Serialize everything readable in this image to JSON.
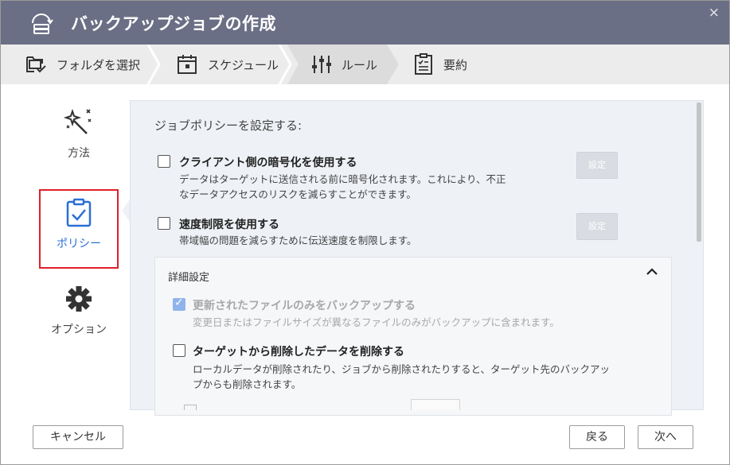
{
  "window": {
    "title": "バックアップジョブの作成",
    "close_glyph": "×"
  },
  "steps": [
    {
      "label": "フォルダを選択",
      "icon": "folder-select-icon"
    },
    {
      "label": "スケジュール",
      "icon": "calendar-icon"
    },
    {
      "label": "ルール",
      "icon": "sliders-icon",
      "active": true
    },
    {
      "label": "要約",
      "icon": "clipboard-summary-icon"
    }
  ],
  "nav": {
    "method": "方法",
    "policy": "ポリシー",
    "option": "オプション"
  },
  "panel": {
    "heading": "ジョブポリシーを設定する:",
    "encryption": {
      "title": "クライアント側の暗号化を使用する",
      "desc1": "データはターゲットに送信される前に暗号化されます。これにより、不正",
      "desc2": "なデータアクセスのリスクを減らすことができます。",
      "button": "設定",
      "checked": false
    },
    "speed": {
      "title": "速度制限を使用する",
      "desc": "帯域幅の問題を減らすために伝送速度を制限します。",
      "button": "設定",
      "checked": false
    },
    "advanced": {
      "heading": "詳細設定",
      "updated_only": {
        "title": "更新されたファイルのみをバックアップする",
        "desc": "変更日またはファイルサイズが異なるファイルのみがバックアップに含まれます。",
        "checked": true
      },
      "delete_target": {
        "title": "ターゲットから削除したデータを削除する",
        "desc1": "ローカルデータが削除されたり、ジョブから削除されたりすると、ターゲット先のバックアッ",
        "desc2": "プからも削除されます。",
        "checked": false
      }
    }
  },
  "footer": {
    "cancel": "キャンセル",
    "back": "戻る",
    "next": "次へ"
  },
  "colors": {
    "titlebar": "#6b6f85",
    "accent": "#2a6fd6",
    "highlight": "#e0202a"
  }
}
